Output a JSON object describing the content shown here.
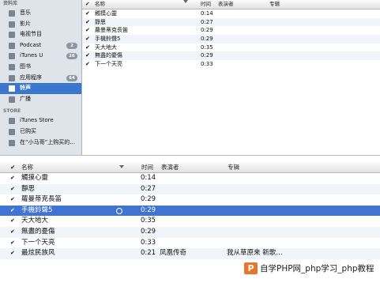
{
  "sidebar": {
    "library_heading": "资料库",
    "library_items": [
      {
        "label": "音乐",
        "icon": "music-note-icon",
        "badge": ""
      },
      {
        "label": "影片",
        "icon": "film-icon",
        "badge": ""
      },
      {
        "label": "电视节目",
        "icon": "tv-icon",
        "badge": ""
      },
      {
        "label": "Podcast",
        "icon": "podcast-icon",
        "badge": "2"
      },
      {
        "label": "iTunes U",
        "icon": "graduation-cap-icon",
        "badge": "26"
      },
      {
        "label": "图书",
        "icon": "book-icon",
        "badge": ""
      },
      {
        "label": "应用程序",
        "icon": "app-icon",
        "badge": "64"
      },
      {
        "label": "铃声",
        "icon": "bell-icon",
        "badge": "",
        "selected": true
      },
      {
        "label": "广播",
        "icon": "radio-icon",
        "badge": ""
      }
    ],
    "store_heading": "STORE",
    "store_items": [
      {
        "label": "iTunes Store",
        "icon": "store-icon"
      },
      {
        "label": "已购买",
        "icon": "purchased-icon"
      },
      {
        "label": "在“小马哥”上购买的…",
        "icon": "purchased-device-icon"
      }
    ]
  },
  "top_list": {
    "columns": {
      "name": "名称",
      "time": "时间",
      "artist": "表演者",
      "album": "专辑"
    },
    "rows": [
      {
        "name": "觸摸心靈",
        "time": "0:14"
      },
      {
        "name": "靜思",
        "time": "0:27"
      },
      {
        "name": "蘿曼蒂克長笛",
        "time": "0:29"
      },
      {
        "name": "手機鈴聲5",
        "time": "0:29"
      },
      {
        "name": "天大地大",
        "time": "0:35"
      },
      {
        "name": "無盡的憂傷",
        "time": "0:29"
      },
      {
        "name": "下一个天亮",
        "time": "0:33"
      }
    ]
  },
  "bottom_list": {
    "columns": {
      "name": "名称",
      "time": "时间",
      "artist": "表演者",
      "album": "专辑"
    },
    "rows": [
      {
        "name": "觸摸心靈",
        "time": "0:14",
        "artist": "",
        "album": ""
      },
      {
        "name": "靜思",
        "time": "0:27",
        "artist": "",
        "album": ""
      },
      {
        "name": "蘿曼蒂克長笛",
        "time": "0:29",
        "artist": "",
        "album": ""
      },
      {
        "name": "手機鈴聲5",
        "time": "0:29",
        "artist": "",
        "album": "",
        "selected": true
      },
      {
        "name": "天大地大",
        "time": "0:35",
        "artist": "",
        "album": ""
      },
      {
        "name": "無盡的憂傷",
        "time": "0:29",
        "artist": "",
        "album": ""
      },
      {
        "name": "下一个天亮",
        "time": "0:33",
        "artist": "",
        "album": ""
      },
      {
        "name": "最炫民族风",
        "time": "0:21",
        "artist": "凤凰传奇",
        "album": "我从草原来 新歌…"
      }
    ]
  },
  "check_mark": "✔",
  "watermark": {
    "logo": "P",
    "text": "自学PHP网_php学习_php教程"
  }
}
